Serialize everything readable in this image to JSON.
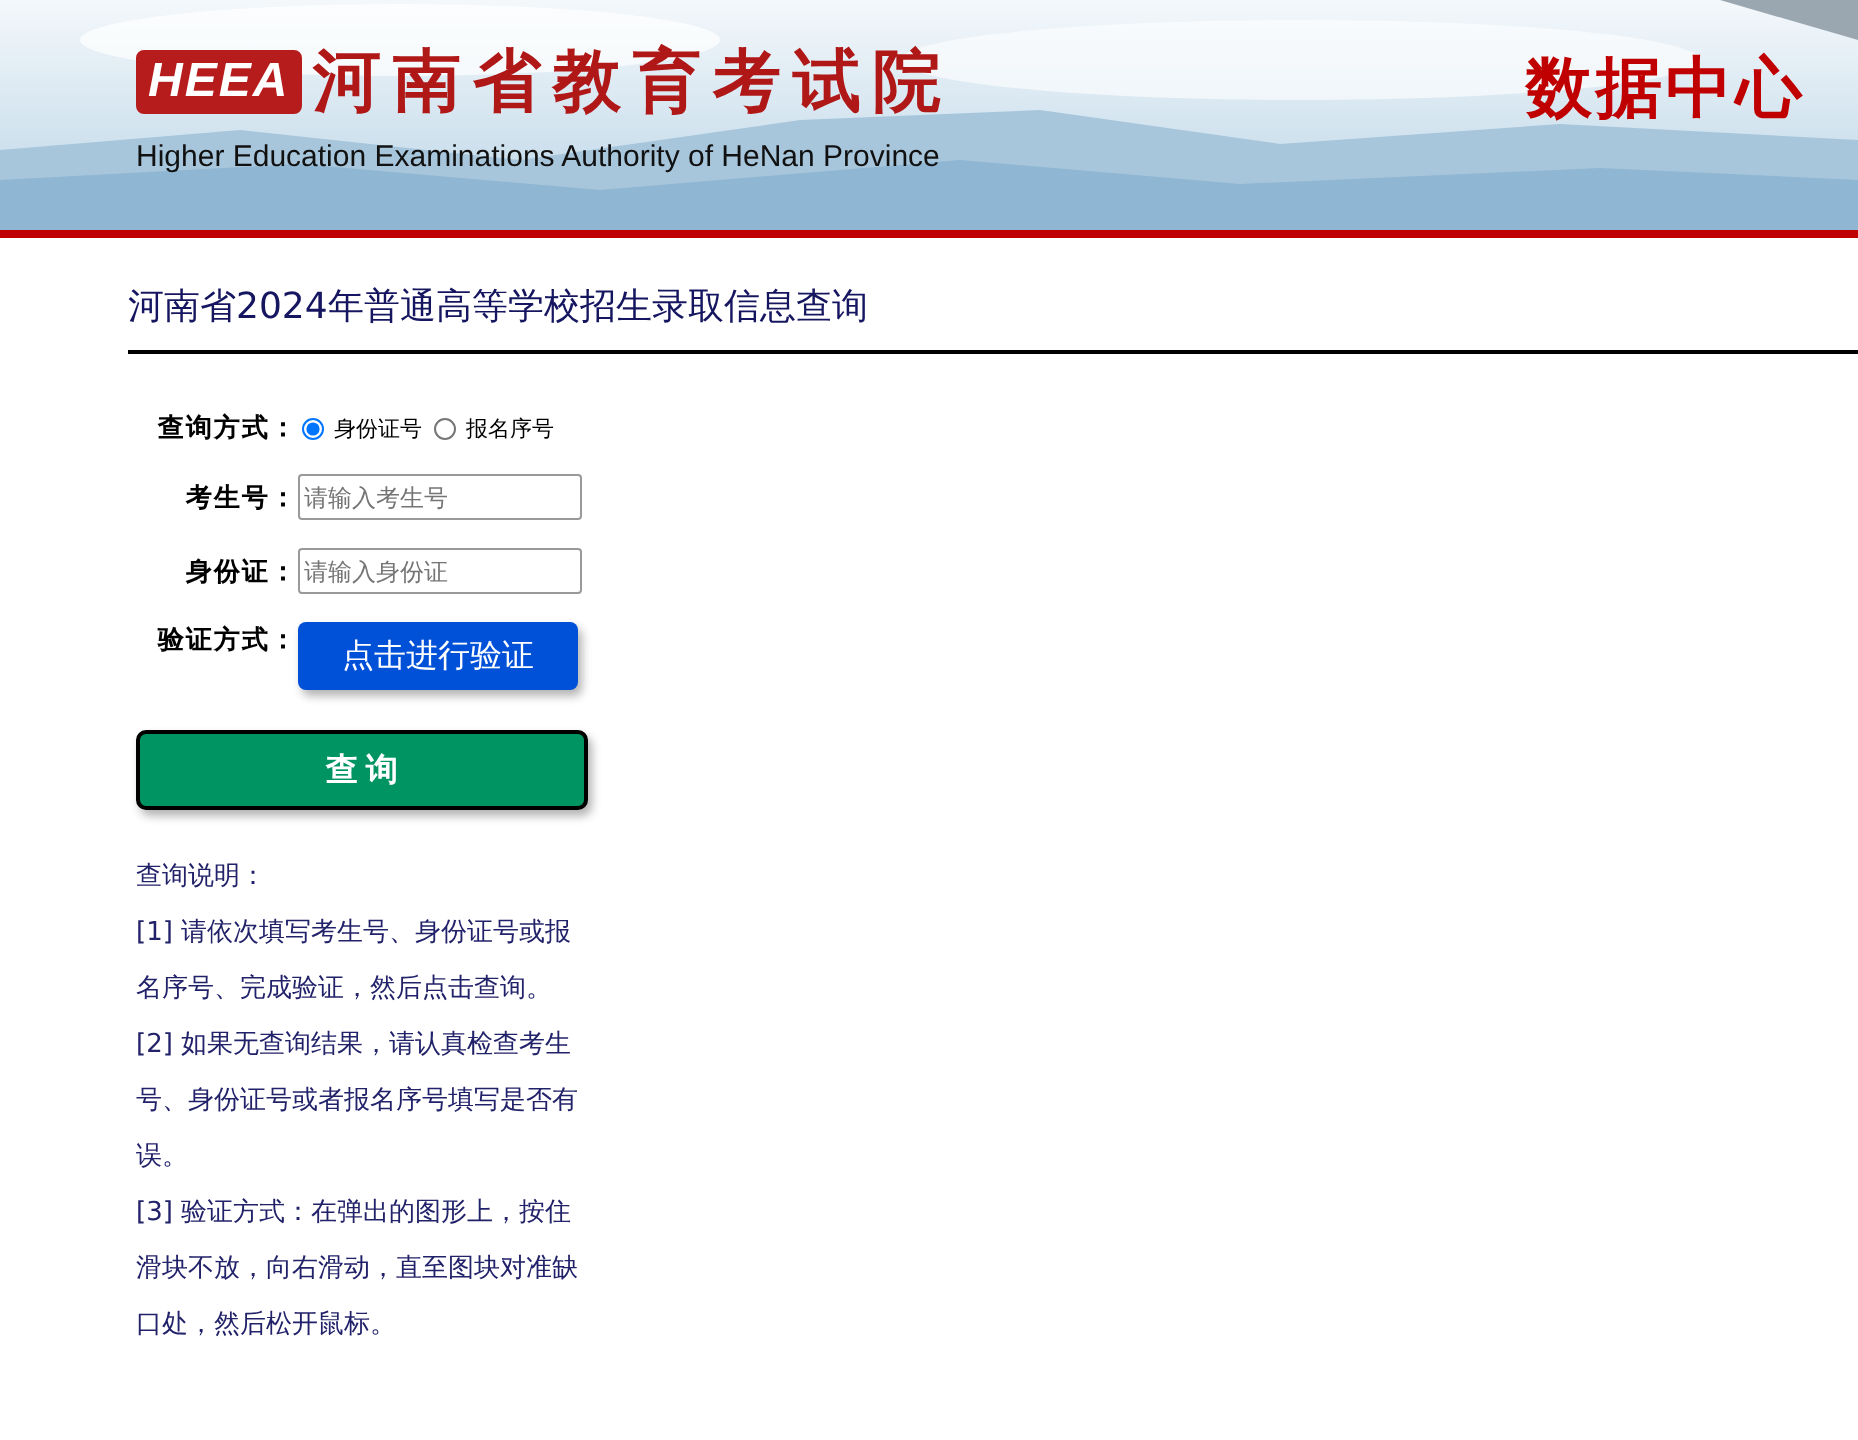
{
  "header": {
    "logo": "HEEA",
    "name": "河南省教育考试院",
    "subtitle": "Higher Education Examinations Authority of HeNan Province",
    "section": "数据中心"
  },
  "page_title": "河南省2024年普通高等学校招生录取信息查询",
  "form": {
    "mode_label": "查询方式：",
    "modes": [
      {
        "label": "身份证号",
        "selected": true
      },
      {
        "label": "报名序号",
        "selected": false
      }
    ],
    "fields": [
      {
        "label": "考生号：",
        "placeholder": "请输入考生号"
      },
      {
        "label": "身份证：",
        "placeholder": "请输入身份证"
      }
    ],
    "verify_label": "验证方式：",
    "verify_button": "点击进行验证",
    "submit_button": "查 询"
  },
  "notes": {
    "title": "查询说明：",
    "items": [
      "[1] 请依次填写考生号、身份证号或报名序号、完成验证，然后点击查询。",
      "[2] 如果无查询结果，请认真检查考生号、身份证号或者报名序号填写是否有误。",
      "[3] 验证方式：在弹出的图形上，按住滑块不放，向右滑动，直至图块对准缺口处，然后松开鼠标。"
    ]
  }
}
